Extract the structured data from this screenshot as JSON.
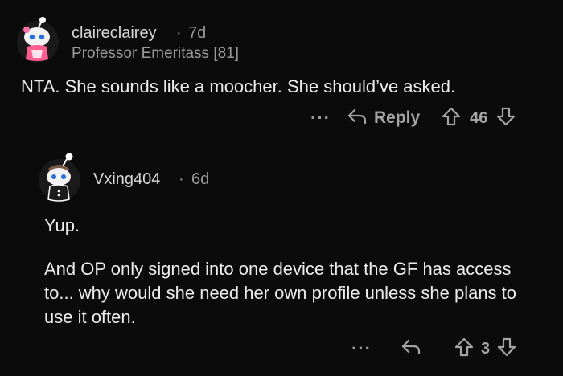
{
  "top_comment": {
    "username": "claireclairey",
    "separator": "·",
    "age": "7d",
    "flair": "Professor Emeritass [81]",
    "body": "NTA. She sounds like a moocher. She should’ve asked.",
    "actions": {
      "more_label": "···",
      "reply_label": "Reply",
      "score": "46"
    }
  },
  "reply_comment": {
    "username": "Vxing404",
    "separator": "·",
    "age": "6d",
    "body_line1": "Yup.",
    "body_paragraph": "And OP only signed into one device that the GF has access to... why would she need her own profile unless she plans to use it often.",
    "actions": {
      "more_label": "···",
      "score": "3"
    }
  },
  "colors": {
    "background": "#0b0b0b",
    "text": "#ececec",
    "muted": "#9a9a9a",
    "thread_line": "#3a3a3a"
  },
  "icons": [
    "snoo-avatar-icon",
    "reply-arrow-icon",
    "upvote-icon",
    "downvote-icon",
    "more-icon"
  ]
}
